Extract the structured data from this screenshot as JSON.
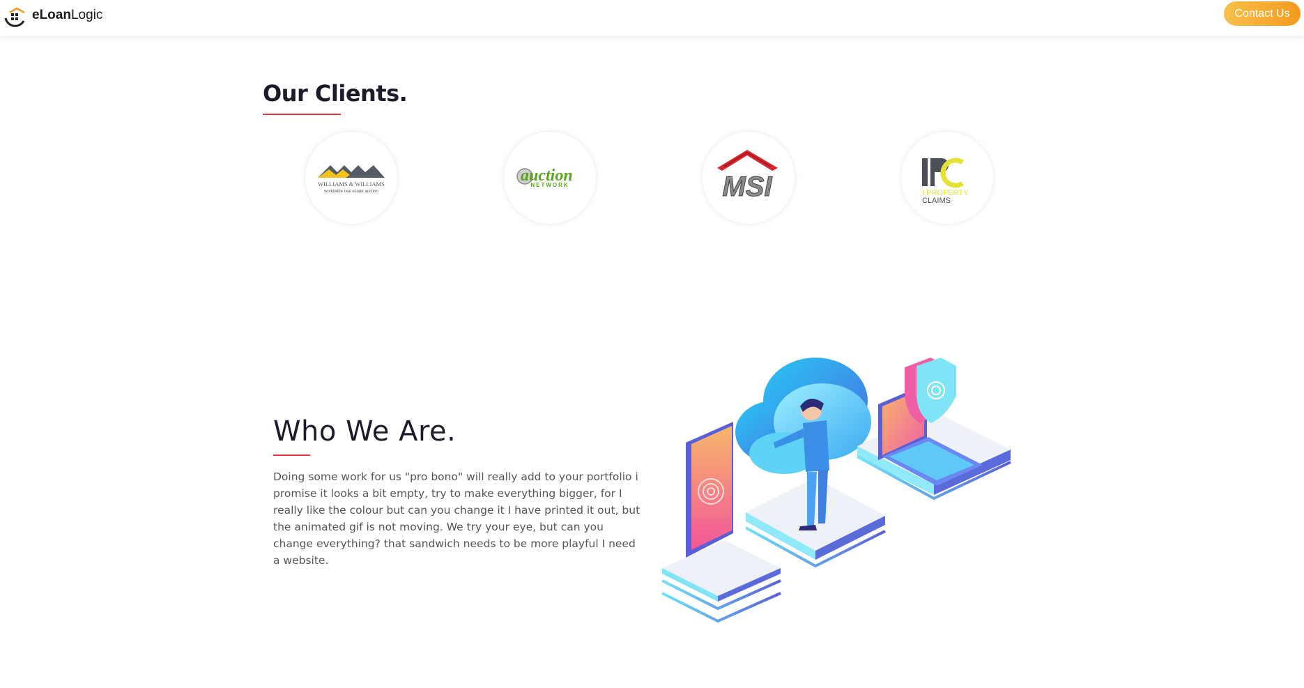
{
  "header": {
    "logo": {
      "brand_bold": "eLoan",
      "brand_regular": "Logic"
    },
    "contact_label": "Contact Us",
    "accent_gradient": [
      "#f7c04a",
      "#f39a1d"
    ]
  },
  "clients": {
    "title": "Our Clients.",
    "underline_color": "#e0393e",
    "logos": [
      {
        "name": "Williams & Williams",
        "line1": "WILLIAMS & WILLIAMS",
        "line2": "worldwide real estate auction"
      },
      {
        "name": "Auction Network",
        "line1": "auction",
        "line2": "NETWORK"
      },
      {
        "name": "MSI",
        "line1": "MSI"
      },
      {
        "name": "I Property Claims",
        "mark": "IPC",
        "line1": "I PROPERTY",
        "line2": "CLAIMS"
      }
    ]
  },
  "who": {
    "title": "Who We Are.",
    "body": "Doing some work for us \"pro bono\" will really add to your portfolio i promise it looks a bit empty, try to make everything bigger, for I really like the colour but can you change it I have printed it out, but the animated gif is not moving. We try your eye, but can you change everything? that sandwich needs to be more playful I need a website."
  }
}
